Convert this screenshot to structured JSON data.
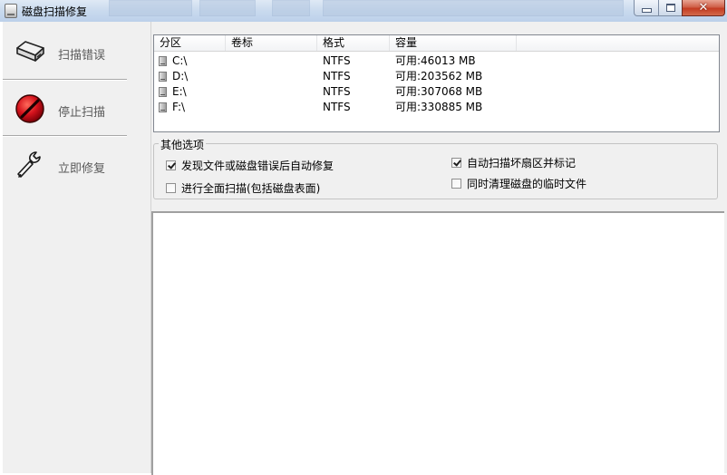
{
  "window": {
    "title": "磁盘扫描修复",
    "close_glyph": "✕"
  },
  "sidebar": {
    "items": [
      {
        "label": "扫描错误",
        "icon": "disk-icon"
      },
      {
        "label": "停止扫描",
        "icon": "stop-icon"
      },
      {
        "label": "立即修复",
        "icon": "wrench-icon"
      }
    ]
  },
  "partitions": {
    "columns": [
      "分区",
      "卷标",
      "格式",
      "容量"
    ],
    "rows": [
      {
        "drive": "C:\\",
        "label": "",
        "format": "NTFS",
        "capacity": "可用:46013 MB",
        "icon": "drive-icon"
      },
      {
        "drive": "D:\\",
        "label": "",
        "format": "NTFS",
        "capacity": "可用:203562 MB",
        "icon": "drive-icon"
      },
      {
        "drive": "E:\\",
        "label": "",
        "format": "NTFS",
        "capacity": "可用:307068 MB",
        "icon": "drive-icon"
      },
      {
        "drive": "F:\\",
        "label": "",
        "format": "NTFS",
        "capacity": "可用:330885 MB",
        "icon": "drive-icon"
      }
    ]
  },
  "options": {
    "title": "其他选项",
    "items": [
      {
        "label": "发现文件或磁盘错误后自动修复",
        "checked": true
      },
      {
        "label": "自动扫描坏扇区并标记",
        "checked": true
      },
      {
        "label": "进行全面扫描(包括磁盘表面)",
        "checked": false
      },
      {
        "label": "同时清理磁盘的临时文件",
        "checked": false
      }
    ]
  },
  "colors": {
    "titlebar": "#c9daee",
    "close_button": "#c43c22",
    "stop_icon": "#c8141e"
  }
}
